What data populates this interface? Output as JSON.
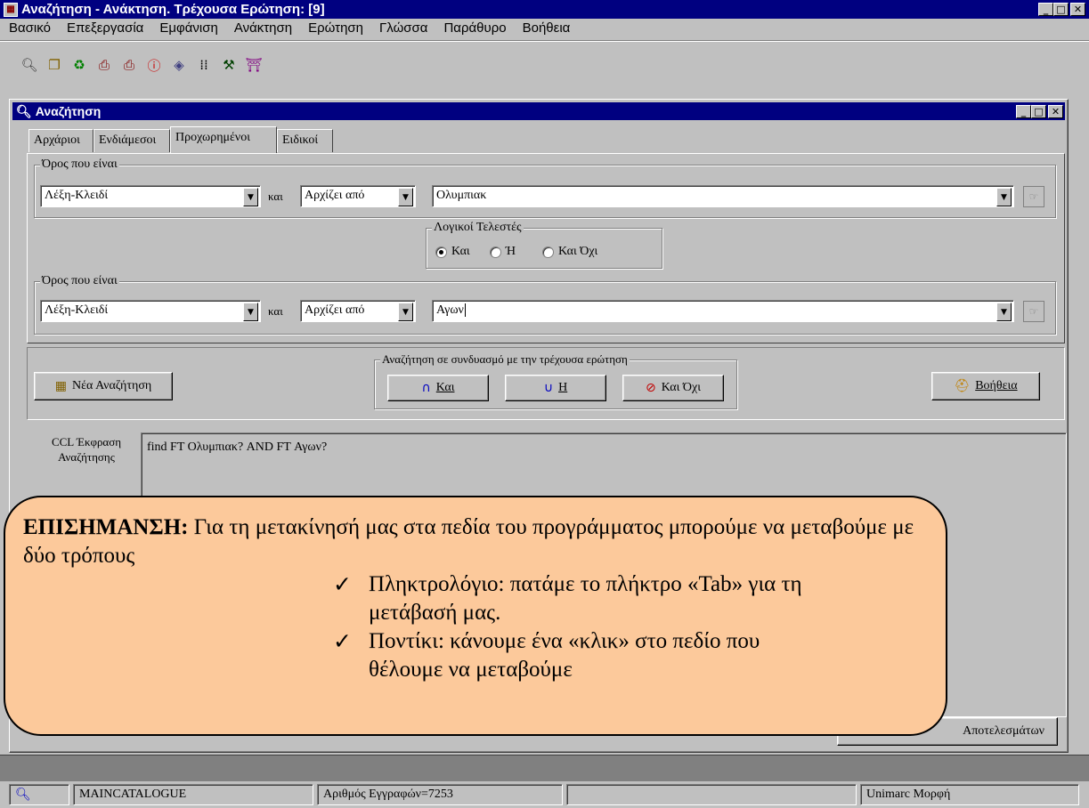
{
  "app": {
    "title": "Αναζήτηση - Ανάκτηση. Τρέχουσα Ερώτηση: [9]",
    "menu": [
      "Βασικό",
      "Επεξεργασία",
      "Εμφάνιση",
      "Ανάκτηση",
      "Ερώτηση",
      "Γλώσσα",
      "Παράθυρο",
      "Βοήθεια"
    ],
    "toolbar_icons": [
      "search-icon",
      "copy-icon",
      "recycle-icon",
      "print-icon",
      "print-setup-icon",
      "info-icon",
      "eraser-icon",
      "grid-icon",
      "tools-icon",
      "exit-icon"
    ]
  },
  "search_window": {
    "title": "Αναζήτηση",
    "tabs": [
      "Αρχάριοι",
      "Ενδιάμεσοι",
      "Προχωρημένοι",
      "Ειδικοί"
    ],
    "active_tab": 2,
    "term1": {
      "group_label": "Όρος που είναι",
      "field": "Λέξη-Κλειδί",
      "conj": "και",
      "match": "Αρχίζει από",
      "value": "Ολυμπιακ"
    },
    "logic": {
      "group_label": "Λογικοί Τελεστές",
      "options": [
        "Και",
        "Ή",
        "Και Όχι"
      ],
      "selected": 0
    },
    "term2": {
      "group_label": "Όρος που είναι",
      "field": "Λέξη-Κλειδί",
      "conj": "και",
      "match": "Αρχίζει από",
      "value": "Αγων"
    },
    "new_search_label": "Νέα Αναζήτηση",
    "combine": {
      "group_label": "Αναζήτηση σε συνδυασμό με την τρέχουσα ερώτηση",
      "and_label": "Και",
      "or_label": "Η",
      "not_label": "Και Όχι"
    },
    "help_label": "Βοήθεια",
    "ccl_label": "CCL Έκφραση Αναζήτησης",
    "ccl_value": "find FT Ολυμπιακ? AND FT Αγων?",
    "results_button": "Αποτελεσμάτων"
  },
  "callout": {
    "heading": "ΕΠΙΣΗΜΑΝΣΗ:",
    "text": "Για τη μετακίνησή μας στα πεδία του προγράμματος μπορούμε να μεταβούμε με δύο τρόπους",
    "bullets": [
      "Πληκτρολόγιο: πατάμε το πλήκτρο «Tab» για τη μετάβασή μας.",
      "Ποντίκι: κάνουμε ένα «κλικ» στο πεδίο που θέλουμε να μεταβούμε"
    ]
  },
  "status": {
    "catalogue": "MAINCATALOGUE",
    "records": "Αριθμός Εγγραφών=7253",
    "format": "Unimarc Μορφή"
  }
}
